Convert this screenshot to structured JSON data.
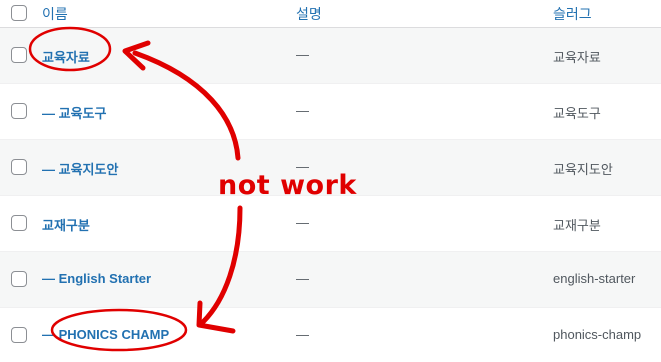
{
  "table": {
    "headers": {
      "name": "이름",
      "description": "설명",
      "slug": "슬러그"
    },
    "rows": [
      {
        "name": "교육자료",
        "description": "—",
        "slug": "교육자료"
      },
      {
        "name": "— 교육도구",
        "description": "—",
        "slug": "교육도구"
      },
      {
        "name": "— 교육지도안",
        "description": "—",
        "slug": "교육지도안"
      },
      {
        "name": "교재구분",
        "description": "—",
        "slug": "교재구분"
      },
      {
        "name": "— English Starter",
        "description": "—",
        "slug": "english-starter"
      },
      {
        "name": "— PHONICS CHAMP",
        "description": "—",
        "slug": "phonics-champ"
      }
    ]
  },
  "annotation": {
    "text": "not work",
    "color": "#e00000"
  },
  "colors": {
    "link": "#2271b1",
    "alt_row": "#f6f7f7",
    "border": "#dcdcde"
  }
}
